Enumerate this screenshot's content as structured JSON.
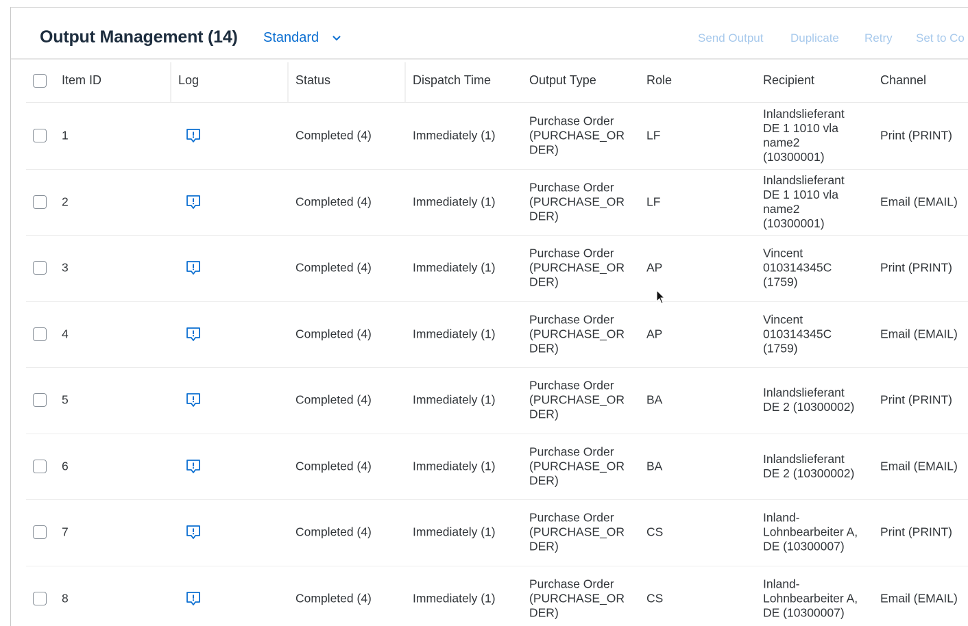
{
  "header": {
    "title": "Output Management (14)",
    "variant": "Standard",
    "actions": [
      "Send Output",
      "Duplicate",
      "Retry",
      "Set to Co"
    ]
  },
  "columns": {
    "item_id": "Item ID",
    "log": "Log",
    "status": "Status",
    "dispatch_time": "Dispatch Time",
    "output_type": "Output Type",
    "role": "Role",
    "recipient": "Recipient",
    "channel": "Channel"
  },
  "rows": [
    {
      "item_id": "1",
      "status": "Completed (4)",
      "dispatch_time": "Immediately (1)",
      "output_type": [
        "Purchase Order",
        "(PURCHASE_OR",
        "DER)"
      ],
      "role": "LF",
      "recipient": [
        "Inlandslieferant",
        "DE 1 1010 vla",
        "name2",
        "(10300001)"
      ],
      "channel": "Print (PRINT)"
    },
    {
      "item_id": "2",
      "status": "Completed (4)",
      "dispatch_time": "Immediately (1)",
      "output_type": [
        "Purchase Order",
        "(PURCHASE_OR",
        "DER)"
      ],
      "role": "LF",
      "recipient": [
        "Inlandslieferant",
        "DE 1 1010 vla",
        "name2",
        "(10300001)"
      ],
      "channel": "Email (EMAIL)"
    },
    {
      "item_id": "3",
      "status": "Completed (4)",
      "dispatch_time": "Immediately (1)",
      "output_type": [
        "Purchase Order",
        "(PURCHASE_OR",
        "DER)"
      ],
      "role": "AP",
      "recipient": [
        "Vincent",
        "010314345C",
        "(1759)"
      ],
      "channel": "Print (PRINT)"
    },
    {
      "item_id": "4",
      "status": "Completed (4)",
      "dispatch_time": "Immediately (1)",
      "output_type": [
        "Purchase Order",
        "(PURCHASE_OR",
        "DER)"
      ],
      "role": "AP",
      "recipient": [
        "Vincent",
        "010314345C",
        "(1759)"
      ],
      "channel": "Email (EMAIL)"
    },
    {
      "item_id": "5",
      "status": "Completed (4)",
      "dispatch_time": "Immediately (1)",
      "output_type": [
        "Purchase Order",
        "(PURCHASE_OR",
        "DER)"
      ],
      "role": "BA",
      "recipient": [
        "Inlandslieferant",
        "DE 2 (10300002)"
      ],
      "channel": "Print (PRINT)"
    },
    {
      "item_id": "6",
      "status": "Completed (4)",
      "dispatch_time": "Immediately (1)",
      "output_type": [
        "Purchase Order",
        "(PURCHASE_OR",
        "DER)"
      ],
      "role": "BA",
      "recipient": [
        "Inlandslieferant",
        "DE 2 (10300002)"
      ],
      "channel": "Email (EMAIL)"
    },
    {
      "item_id": "7",
      "status": "Completed (4)",
      "dispatch_time": "Immediately (1)",
      "output_type": [
        "Purchase Order",
        "(PURCHASE_OR",
        "DER)"
      ],
      "role": "CS",
      "recipient": [
        "Inland-",
        "Lohnbearbeiter A,",
        "DE (10300007)"
      ],
      "channel": "Print (PRINT)"
    },
    {
      "item_id": "8",
      "status": "Completed (4)",
      "dispatch_time": "Immediately (1)",
      "output_type": [
        "Purchase Order",
        "(PURCHASE_OR",
        "DER)"
      ],
      "role": "CS",
      "recipient": [
        "Inland-",
        "Lohnbearbeiter A,",
        "DE (10300007)"
      ],
      "channel": "Email (EMAIL)"
    }
  ],
  "icons": {
    "variant_dropdown": "chevron-down-icon",
    "log": "message-info-icon",
    "pointer": "mouse-cursor-icon"
  },
  "colors": {
    "accent": "#0a6ed1",
    "disabled_action": "#a7c9ec",
    "text": "#32363a",
    "title": "#1d2d3e"
  }
}
